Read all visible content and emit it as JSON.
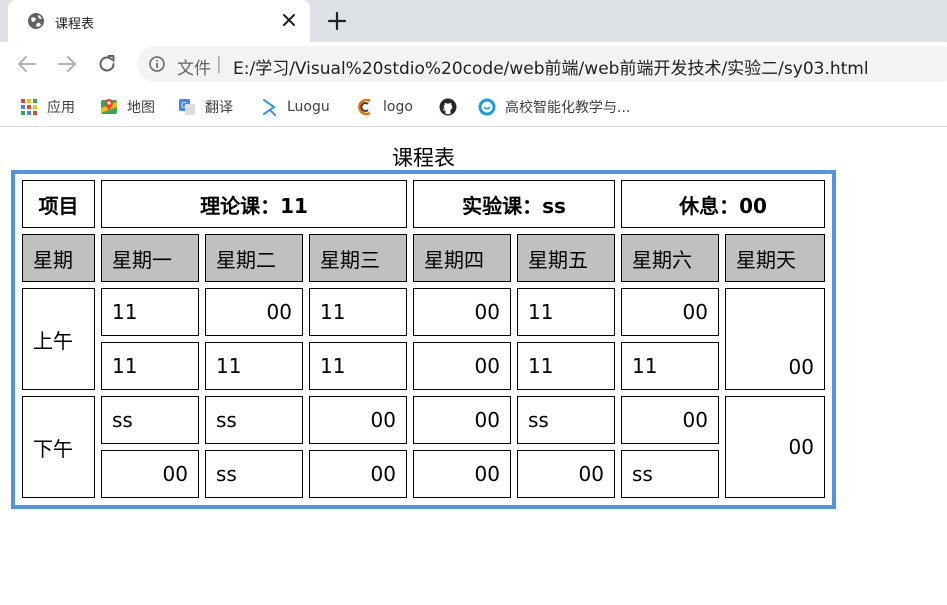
{
  "browser": {
    "tab": {
      "title": "课程表"
    },
    "address_bar": {
      "security_label": "文件",
      "separator": "|",
      "url": "E:/学习/Visual%20stdio%20code/web前端/web前端开发技术/实验二/sy03.html"
    },
    "bookmarks": [
      {
        "label": "应用",
        "icon": "apps-grid-icon"
      },
      {
        "label": "地图",
        "icon": "maps-icon"
      },
      {
        "label": "翻译",
        "icon": "translate-icon"
      },
      {
        "label": "Luogu",
        "icon": "luogu-icon"
      },
      {
        "label": "logo",
        "icon": "logo-icon"
      },
      {
        "label": "",
        "icon": "github-icon"
      },
      {
        "label": "高校智能化教学与...",
        "icon": "smart-teaching-icon"
      }
    ]
  },
  "page": {
    "title": "课程表",
    "table": {
      "header": {
        "item": "项目",
        "theory": "理论课：11",
        "lab": "实验课：ss",
        "rest": "休息：00"
      },
      "weekday_label": "星期",
      "weekdays": [
        "星期一",
        "星期二",
        "星期三",
        "星期四",
        "星期五",
        "星期六",
        "星期天"
      ],
      "morning_label": "上午",
      "afternoon_label": "下午",
      "morning_rows": [
        [
          "11",
          "00",
          "11",
          "00",
          "11",
          "00"
        ],
        [
          "11",
          "11",
          "11",
          "00",
          "11",
          "11"
        ]
      ],
      "morning_sunday": "00",
      "afternoon_rows": [
        [
          "ss",
          "ss",
          "00",
          "00",
          "ss",
          "00"
        ],
        [
          "00",
          "ss",
          "00",
          "00",
          "00",
          "ss"
        ]
      ],
      "afternoon_sunday": "00"
    }
  },
  "colors": {
    "table_border": "#5294e2",
    "weekday_bg": "#c0c0c0",
    "tabstrip_bg": "#dee1e6"
  }
}
